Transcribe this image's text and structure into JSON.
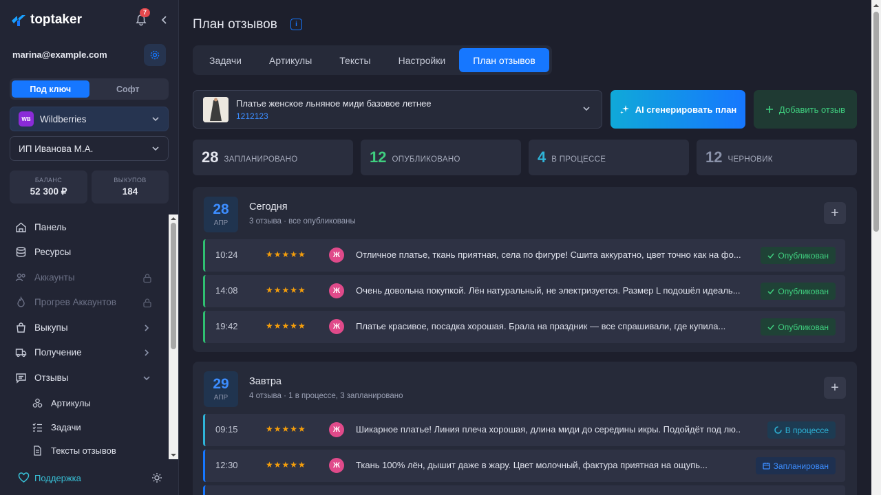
{
  "brand": {
    "name": "toptaker",
    "notifications": "7"
  },
  "user": {
    "email": "marina@example.com"
  },
  "mode_toggle": {
    "options": [
      "Под ключ",
      "Софт"
    ],
    "selected": "Под ключ"
  },
  "marketplace": {
    "badge": "WB",
    "name": "Wildberries"
  },
  "entity": {
    "name": "ИП Иванова М.А."
  },
  "stats": {
    "balance_label": "БАЛАНС",
    "balance_value": "52 300 ₽",
    "purchases_label": "ВЫКУПОВ",
    "purchases_value": "184"
  },
  "nav": {
    "items": [
      {
        "label": "Панель",
        "icon": "home-icon"
      },
      {
        "label": "Ресурсы",
        "icon": "database-icon"
      },
      {
        "label": "Аккаунты",
        "icon": "users-icon",
        "locked": true
      },
      {
        "label": "Прогрев Аккаунтов",
        "icon": "flame-icon",
        "locked": true
      },
      {
        "label": "Выкупы",
        "icon": "bag-icon"
      },
      {
        "label": "Получение",
        "icon": "truck-icon"
      },
      {
        "label": "Отзывы",
        "icon": "chat-icon",
        "expanded": true
      }
    ],
    "subitems": [
      {
        "label": "Артикулы",
        "icon": "boxes-icon"
      },
      {
        "label": "Задачи",
        "icon": "tasks-icon"
      },
      {
        "label": "Тексты отзывов",
        "icon": "document-icon"
      }
    ]
  },
  "support": {
    "label": "Поддержка"
  },
  "page": {
    "title": "План отзывов"
  },
  "tabs": [
    "Задачи",
    "Артикулы",
    "Тексты",
    "Настройки",
    "План отзывов"
  ],
  "active_tab": "План отзывов",
  "product": {
    "title": "Платье женское льняное миди базовое летнее",
    "sku": "1212123"
  },
  "actions": {
    "ai_label": "AI сгенерировать план",
    "add_label": "Добавить отзыв"
  },
  "summary": [
    {
      "count": "28",
      "label": "ЗАПЛАНИРОВАНО",
      "color": "#e6e8f0"
    },
    {
      "count": "12",
      "label": "ОПУБЛИКОВАНО",
      "color": "#3fcf7f"
    },
    {
      "count": "4",
      "label": "В ПРОЦЕССЕ",
      "color": "#2fb4d8"
    },
    {
      "count": "12",
      "label": "ЧЕРНОВИК",
      "color": "#8b93aa"
    }
  ],
  "days": [
    {
      "day": "28",
      "month": "АПР",
      "title": "Сегодня",
      "subtitle": "3 отзыва · все опубликованы",
      "reviews": [
        {
          "time": "10:24",
          "stars": "★★★★★",
          "gender": "Ж",
          "text": "Отличное платье, ткань приятная, села по фигуре! Сшита аккуратно, цвет точно как на фо...",
          "status": "Опубликован",
          "status_kind": "ok"
        },
        {
          "time": "14:08",
          "stars": "★★★★★",
          "gender": "Ж",
          "text": "Очень довольна покупкой. Лён натуральный, не электризуется. Размер L подошёл идеаль...",
          "status": "Опубликован",
          "status_kind": "ok"
        },
        {
          "time": "19:42",
          "stars": "★★★★★",
          "gender": "Ж",
          "text": "Платье красивое, посадка хорошая. Брала на праздник — все спрашивали, где купила...",
          "status": "Опубликован",
          "status_kind": "ok"
        }
      ]
    },
    {
      "day": "29",
      "month": "АПР",
      "title": "Завтра",
      "subtitle": "4 отзыва · 1 в процессе, 3 запланировано",
      "reviews": [
        {
          "time": "09:15",
          "stars": "★★★★★",
          "gender": "Ж",
          "text": "Шикарное платье! Линия плеча хорошая, длина миди до середины икры. Подойдёт под лю...",
          "status": "В процессе",
          "status_kind": "prog"
        },
        {
          "time": "12:30",
          "stars": "★★★★★",
          "gender": "Ж",
          "text": "Ткань 100% лён, дышит даже в жару. Цвет молочный, фактура приятная на ощупь...",
          "status": "Запланирован",
          "status_kind": "plan"
        }
      ]
    }
  ]
}
